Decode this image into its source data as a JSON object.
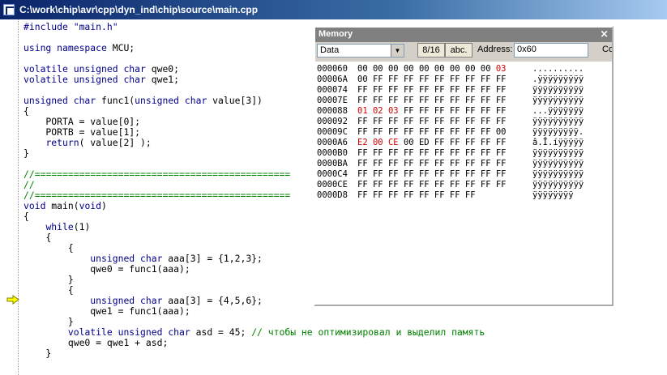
{
  "window": {
    "title": "C:\\work\\chip\\avr\\cpp\\dyn_ind\\chip\\source\\main.cpp"
  },
  "code": {
    "lines": [
      [
        {
          "t": "#include \"main.h\"",
          "c": "kw"
        }
      ],
      [],
      [
        {
          "t": "using namespace",
          "c": "kw"
        },
        {
          "t": " MCU;"
        }
      ],
      [],
      [
        {
          "t": "volatile unsigned char",
          "c": "kw"
        },
        {
          "t": " qwe0;"
        }
      ],
      [
        {
          "t": "volatile unsigned char",
          "c": "kw"
        },
        {
          "t": " qwe1;"
        }
      ],
      [],
      [
        {
          "t": "unsigned char",
          "c": "kw"
        },
        {
          "t": " func1("
        },
        {
          "t": "unsigned char",
          "c": "kw"
        },
        {
          "t": " value[3])"
        }
      ],
      [
        {
          "t": "{"
        }
      ],
      [
        {
          "t": "    PORTA = value[0];"
        }
      ],
      [
        {
          "t": "    PORTB = value[1];"
        }
      ],
      [
        {
          "t": "    "
        },
        {
          "t": "return",
          "c": "kw"
        },
        {
          "t": "( value[2] );"
        }
      ],
      [
        {
          "t": "}"
        }
      ],
      [],
      [
        {
          "t": "//==============================================",
          "c": "cm"
        }
      ],
      [
        {
          "t": "//",
          "c": "cm"
        }
      ],
      [
        {
          "t": "//==============================================",
          "c": "cm"
        }
      ],
      [
        {
          "t": "void",
          "c": "kw"
        },
        {
          "t": " main("
        },
        {
          "t": "void",
          "c": "kw"
        },
        {
          "t": ")"
        }
      ],
      [
        {
          "t": "{"
        }
      ],
      [
        {
          "t": "    "
        },
        {
          "t": "while",
          "c": "kw"
        },
        {
          "t": "(1)"
        }
      ],
      [
        {
          "t": "    {"
        }
      ],
      [
        {
          "t": "        {"
        }
      ],
      [
        {
          "t": "            "
        },
        {
          "t": "unsigned char",
          "c": "kw"
        },
        {
          "t": " aaa[3] = {1,2,3};"
        }
      ],
      [
        {
          "t": "            qwe0 = func1(aaa);"
        }
      ],
      [
        {
          "t": "        }"
        }
      ],
      [
        {
          "t": "        {"
        }
      ],
      [
        {
          "t": "            "
        },
        {
          "t": "unsigned char",
          "c": "kw"
        },
        {
          "t": " aaa[3] = {4,5,6};"
        }
      ],
      [
        {
          "t": "            qwe1 = func1(aaa);"
        }
      ],
      [
        {
          "t": "        }"
        }
      ],
      [
        {
          "t": "        "
        },
        {
          "t": "volatile unsigned char",
          "c": "kw"
        },
        {
          "t": " asd = 45; "
        },
        {
          "t": "// чтобы не оптимизировал и выделил память",
          "c": "cm"
        }
      ],
      [
        {
          "t": "        qwe0 = qwe1 + asd;"
        }
      ],
      [
        {
          "t": "    }"
        }
      ]
    ],
    "current_line": 27
  },
  "memory": {
    "title": "Memory",
    "close": "×",
    "space": "Data",
    "btn_816": "8/16",
    "btn_abc": "abc.",
    "address_label": "Address:",
    "address_value": "0x60",
    "truncated": "Co",
    "rows": [
      {
        "addr": "000060",
        "bytes": [
          "00",
          "00",
          "00",
          "00",
          "00",
          "00",
          "00",
          "00",
          "00",
          "03"
        ],
        "changed": [
          9
        ],
        "ascii": ".........."
      },
      {
        "addr": "00006A",
        "bytes": [
          "00",
          "FF",
          "FF",
          "FF",
          "FF",
          "FF",
          "FF",
          "FF",
          "FF",
          "FF"
        ],
        "changed": [],
        "ascii": ".ÿÿÿÿÿÿÿÿÿ"
      },
      {
        "addr": "000074",
        "bytes": [
          "FF",
          "FF",
          "FF",
          "FF",
          "FF",
          "FF",
          "FF",
          "FF",
          "FF",
          "FF"
        ],
        "changed": [],
        "ascii": "ÿÿÿÿÿÿÿÿÿÿ"
      },
      {
        "addr": "00007E",
        "bytes": [
          "FF",
          "FF",
          "FF",
          "FF",
          "FF",
          "FF",
          "FF",
          "FF",
          "FF",
          "FF"
        ],
        "changed": [],
        "ascii": "ÿÿÿÿÿÿÿÿÿÿ"
      },
      {
        "addr": "000088",
        "bytes": [
          "01",
          "02",
          "03",
          "FF",
          "FF",
          "FF",
          "FF",
          "FF",
          "FF",
          "FF"
        ],
        "changed": [
          0,
          1,
          2
        ],
        "ascii": "...ÿÿÿÿÿÿÿ"
      },
      {
        "addr": "000092",
        "bytes": [
          "FF",
          "FF",
          "FF",
          "FF",
          "FF",
          "FF",
          "FF",
          "FF",
          "FF",
          "FF"
        ],
        "changed": [],
        "ascii": "ÿÿÿÿÿÿÿÿÿÿ"
      },
      {
        "addr": "00009C",
        "bytes": [
          "FF",
          "FF",
          "FF",
          "FF",
          "FF",
          "FF",
          "FF",
          "FF",
          "FF",
          "00"
        ],
        "changed": [],
        "ascii": "ÿÿÿÿÿÿÿÿÿ."
      },
      {
        "addr": "0000A6",
        "bytes": [
          "E2",
          "00",
          "CE",
          "00",
          "ED",
          "FF",
          "FF",
          "FF",
          "FF",
          "FF"
        ],
        "changed": [
          0,
          1,
          2
        ],
        "ascii": "â.Î.íÿÿÿÿÿ"
      },
      {
        "addr": "0000B0",
        "bytes": [
          "FF",
          "FF",
          "FF",
          "FF",
          "FF",
          "FF",
          "FF",
          "FF",
          "FF",
          "FF"
        ],
        "changed": [],
        "ascii": "ÿÿÿÿÿÿÿÿÿÿ"
      },
      {
        "addr": "0000BA",
        "bytes": [
          "FF",
          "FF",
          "FF",
          "FF",
          "FF",
          "FF",
          "FF",
          "FF",
          "FF",
          "FF"
        ],
        "changed": [],
        "ascii": "ÿÿÿÿÿÿÿÿÿÿ"
      },
      {
        "addr": "0000C4",
        "bytes": [
          "FF",
          "FF",
          "FF",
          "FF",
          "FF",
          "FF",
          "FF",
          "FF",
          "FF",
          "FF"
        ],
        "changed": [],
        "ascii": "ÿÿÿÿÿÿÿÿÿÿ"
      },
      {
        "addr": "0000CE",
        "bytes": [
          "FF",
          "FF",
          "FF",
          "FF",
          "FF",
          "FF",
          "FF",
          "FF",
          "FF",
          "FF"
        ],
        "changed": [],
        "ascii": "ÿÿÿÿÿÿÿÿÿÿ"
      },
      {
        "addr": "0000D8",
        "bytes": [
          "FF",
          "FF",
          "FF",
          "FF",
          "FF",
          "FF",
          "FF",
          "FF"
        ],
        "changed": [],
        "ascii": "ÿÿÿÿÿÿÿÿ"
      }
    ]
  },
  "colors": {
    "keyword": "#00008b",
    "comment": "#008000",
    "changed_byte": "#d00000",
    "title_bar": "#0a246a"
  }
}
